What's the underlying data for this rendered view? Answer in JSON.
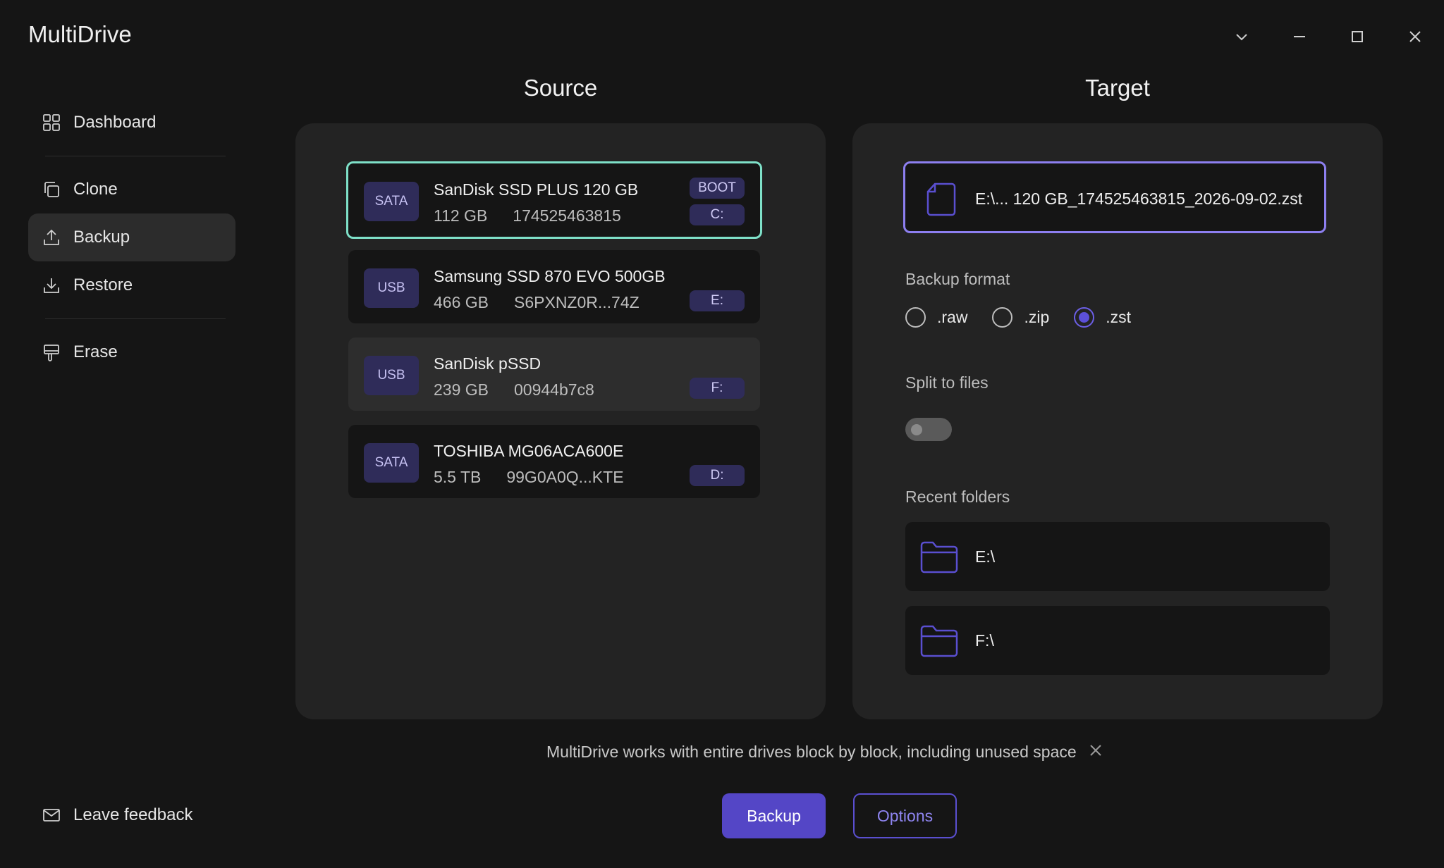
{
  "app": {
    "title": "MultiDrive"
  },
  "window": {
    "controls": [
      "chevron-down",
      "minimize",
      "maximize",
      "close"
    ]
  },
  "sidebar": {
    "items": [
      {
        "label": "Dashboard",
        "icon": "grid-icon"
      },
      {
        "label": "Clone",
        "icon": "copy-icon"
      },
      {
        "label": "Backup",
        "icon": "upload-icon",
        "active": true
      },
      {
        "label": "Restore",
        "icon": "download-icon"
      },
      {
        "label": "Erase",
        "icon": "eraser-icon"
      }
    ],
    "feedback": {
      "label": "Leave feedback",
      "icon": "mail-icon"
    }
  },
  "source": {
    "title": "Source",
    "drives": [
      {
        "type": "SATA",
        "name": "SanDisk SSD PLUS 120 GB",
        "size": "112 GB",
        "serial": "174525463815",
        "badge_top": "BOOT",
        "letter": "C:",
        "selected": true
      },
      {
        "type": "USB",
        "name": "Samsung SSD 870 EVO 500GB",
        "size": "466 GB",
        "serial": "S6PXNZ0R...74Z",
        "letter": "E:"
      },
      {
        "type": "USB",
        "name": "SanDisk pSSD",
        "size": "239 GB",
        "serial": "00944b7c8",
        "letter": "F:"
      },
      {
        "type": "SATA",
        "name": "TOSHIBA MG06ACA600E",
        "size": "5.5 TB",
        "serial": "99G0A0Q...KTE",
        "letter": "D:"
      }
    ]
  },
  "target": {
    "title": "Target",
    "file_path": "E:\\... 120 GB_174525463815_2026-09-02.zst",
    "format_label": "Backup format",
    "formats": [
      {
        "label": ".raw",
        "checked": false
      },
      {
        "label": ".zip",
        "checked": false
      },
      {
        "label": ".zst",
        "checked": true
      }
    ],
    "split_label": "Split to files",
    "split_enabled": false,
    "recent_label": "Recent folders",
    "recent_folders": [
      "E:\\",
      "F:\\"
    ]
  },
  "notice": {
    "text": "MultiDrive works with entire drives block by block, including unused space"
  },
  "actions": {
    "primary": "Backup",
    "secondary": "Options"
  },
  "colors": {
    "accent": "#5446c6",
    "selected_border": "#7ee0c8",
    "target_border": "#8d7ff0"
  }
}
